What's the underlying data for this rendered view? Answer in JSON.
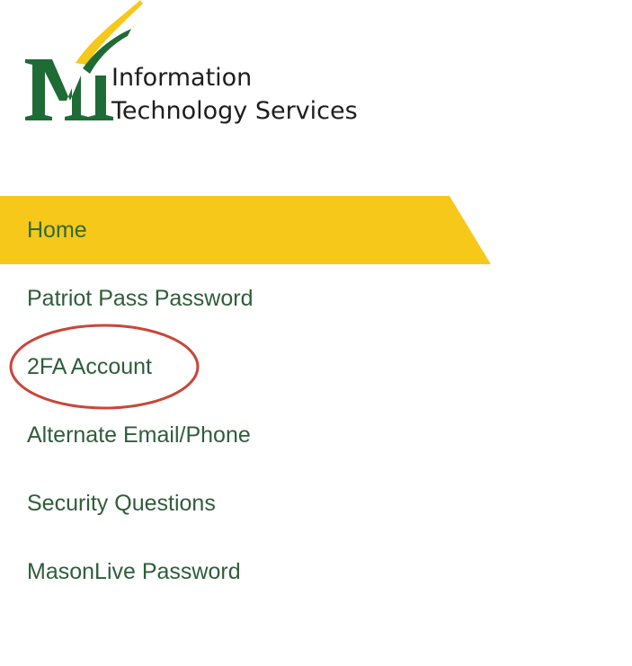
{
  "brand": {
    "line1": "Information",
    "line2": "Technology Services",
    "logo_icon": "mason-m-logo-icon",
    "colors": {
      "green": "#1f6b36",
      "gold": "#f6c81a"
    }
  },
  "nav": {
    "active_color": "#f6c81a",
    "items": [
      {
        "label": "Home",
        "active": true
      },
      {
        "label": "Patriot Pass Password",
        "active": false
      },
      {
        "label": "2FA Account",
        "active": false,
        "circled": true
      },
      {
        "label": "Alternate Email/Phone",
        "active": false
      },
      {
        "label": "Security Questions",
        "active": false
      },
      {
        "label": "MasonLive Password",
        "active": false
      }
    ]
  },
  "annotation": {
    "color": "#c9463a",
    "target": "2FA Account"
  }
}
